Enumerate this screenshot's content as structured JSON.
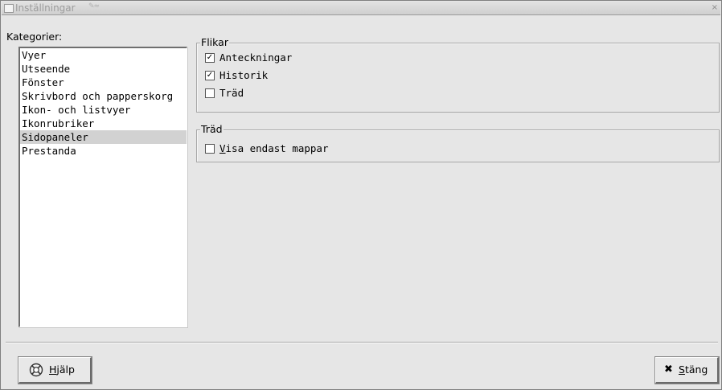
{
  "window": {
    "title": "Inställningar"
  },
  "categories": {
    "label": "Kategorier:",
    "items": [
      {
        "label": "Vyer"
      },
      {
        "label": "Utseende"
      },
      {
        "label": "Fönster"
      },
      {
        "label": "Skrivbord och papperskorg"
      },
      {
        "label": "Ikon- och listvyer"
      },
      {
        "label": "Ikonrubriker"
      },
      {
        "label": "Sidopaneler",
        "selected": true
      },
      {
        "label": "Prestanda"
      }
    ]
  },
  "flikar": {
    "title": "Flikar",
    "options": [
      {
        "label": "Anteckningar",
        "checked": true
      },
      {
        "label": "Historik",
        "checked": true
      },
      {
        "label": "Träd",
        "checked": false
      }
    ]
  },
  "trad": {
    "title": "Träd",
    "show_folders_only": {
      "mnemonic": "V",
      "rest": "isa endast mappar",
      "checked": false
    }
  },
  "buttons": {
    "help": {
      "mnemonic": "H",
      "rest": "jälp",
      "icon": "lifebuoy-icon"
    },
    "close": {
      "mnemonic": "S",
      "rest": "täng",
      "icon": "close-icon"
    }
  }
}
